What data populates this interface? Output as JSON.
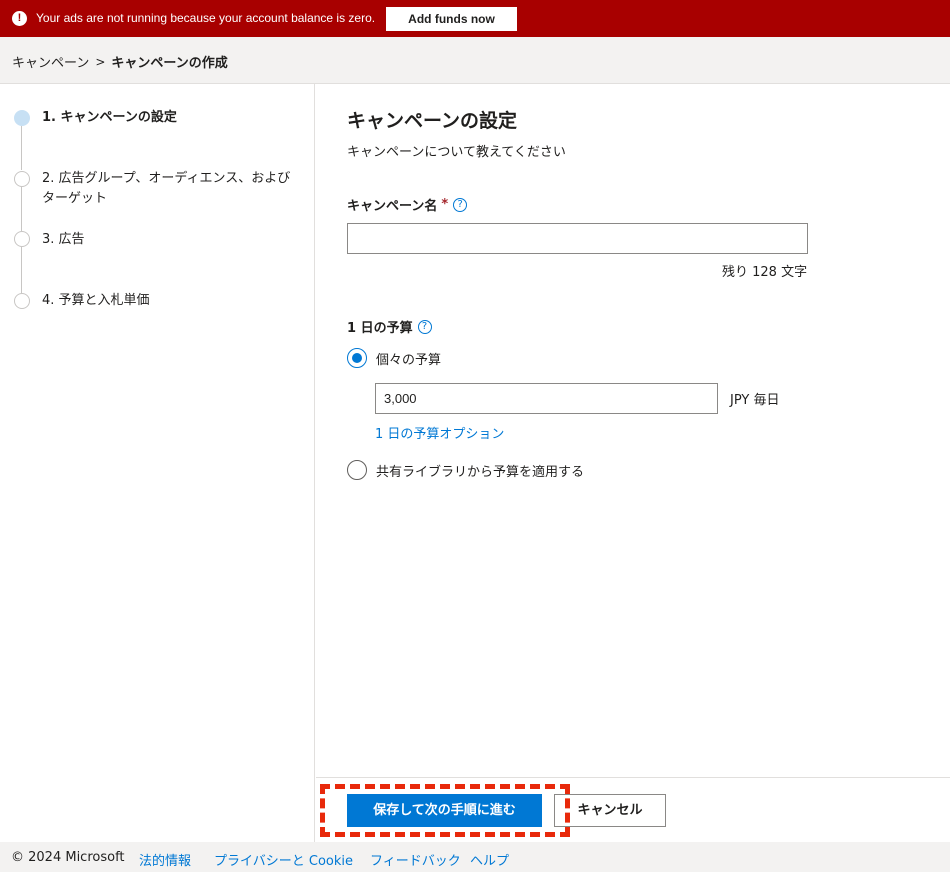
{
  "alert": {
    "icon": "exclamation-icon",
    "message": "Your ads are not running because your account balance is zero.",
    "button_label": "Add funds now",
    "background_color": "#a80000"
  },
  "breadcrumb": {
    "parent": "キャンペーン",
    "separator": ">",
    "current": "キャンペーンの作成"
  },
  "steps": [
    {
      "label": "1. キャンペーンの設定",
      "state": "active"
    },
    {
      "label": "2. 広告グループ、オーディエンス、およびターゲット",
      "state": "pending"
    },
    {
      "label": "3. 広告",
      "state": "pending"
    },
    {
      "label": "4. 予算と入札単価",
      "state": "pending"
    }
  ],
  "main": {
    "title": "キャンペーンの設定",
    "subtitle": "キャンペーンについて教えてください",
    "campaign_name": {
      "label": "キャンペーン名",
      "required_marker": "*",
      "help_icon": "?",
      "value": "",
      "remaining": "残り 128 文字"
    },
    "daily_budget": {
      "label": "1 日の予算",
      "help_icon": "?",
      "options": [
        {
          "label": "個々の予算",
          "selected": true
        },
        {
          "label": "共有ライブラリから予算を適用する",
          "selected": false
        }
      ],
      "amount": "3,000",
      "unit": "JPY  毎日",
      "options_link": "1 日の予算オプション"
    }
  },
  "actions": {
    "primary_label": "保存して次の手順に進む",
    "secondary_label": "キャンセル",
    "highlight_color": "#e8290b"
  },
  "footer": {
    "copyright": "© 2024 Microsoft",
    "links": [
      "法的情報",
      "プライバシーと Cookie",
      "フィードバック",
      "ヘルプ"
    ]
  },
  "colors": {
    "accent": "#0078d4",
    "alert": "#a80000",
    "active_step": "#c7e0f4"
  }
}
